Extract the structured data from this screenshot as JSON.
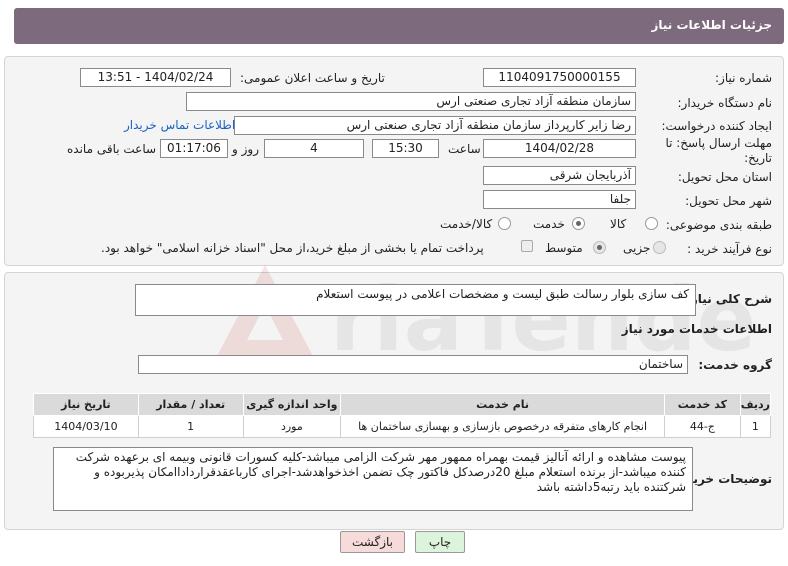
{
  "header": {
    "title": "جزئیات اطلاعات نیاز"
  },
  "form": {
    "need_number_label": "شماره نیاز:",
    "need_number": "1104091750000155",
    "announce_label": "تاریخ و ساعت اعلان عمومی:",
    "announce_value": "1404/02/24 - 13:51",
    "buyer_org_label": "نام دستگاه خریدار:",
    "buyer_org": "سازمان منطقه آزاد تجاری صنعتی ارس",
    "creator_label": "ایجاد کننده درخواست:",
    "creator": "رضا زایر کارپرداز سازمان منطقه آزاد تجاری صنعتی ارس",
    "contact_link": "اطلاعات تماس خریدار",
    "deadline_label_1": "مهلت ارسال پاسخ: تا",
    "deadline_label_2": "تاریخ:",
    "deadline_date": "1404/02/28",
    "time_label": "ساعت",
    "deadline_time": "15:30",
    "days_value": "4",
    "days_label": "روز و",
    "remaining_time": "01:17:06",
    "remaining_label": "ساعت باقی مانده",
    "province_label": "استان محل تحویل:",
    "province": "آذربایجان شرقی",
    "city_label": "شهر محل تحویل:",
    "city": "جلفا",
    "category_label": "طبقه بندی موضوعی:",
    "category_options": [
      "کالا",
      "خدمت",
      "کالا/خدمت"
    ],
    "category_selected": "خدمت",
    "process_label": "نوع فرآیند خرید :",
    "process_options": [
      "جزیی",
      "متوسط"
    ],
    "process_selected": "متوسط",
    "payment_note": "پرداخت تمام یا بخشی از مبلغ خرید،از محل \"اسناد خزانه اسلامی\" خواهد بود."
  },
  "summary": {
    "label": "شرح کلی نیاز:",
    "text": "کف سازی بلوار رسالت طبق لیست و مضخصات اعلامی در پیوست استعلام"
  },
  "services": {
    "section_title": "اطلاعات خدمات مورد نیاز",
    "group_label": "گروه خدمت:",
    "group_value": "ساختمان",
    "columns": [
      "ردیف",
      "کد خدمت",
      "نام خدمت",
      "واحد اندازه گیری",
      "تعداد / مقدار",
      "تاریخ نیاز"
    ],
    "rows": [
      [
        "1",
        "ج-44",
        "انجام کارهای متفرقه درخصوص بازسازی و بهسازی ساختمان ها",
        "مورد",
        "1",
        "1404/03/10"
      ]
    ]
  },
  "buyer_notes": {
    "label": "توضیحات خریدار:",
    "text": "پیوست مشاهده و ارائه آنالیز قیمت بهمراه ممهور مهر شرکت الزامی میباشد-کلیه کسورات قانونی وبیمه ای برعهده شرکت کننده میباشد-از برنده استعلام مبلغ 20درصدکل فاکتور چک تضمن اخذخواهدشد-اجرای کارباعقدقرارداداامکان پذیربوده و شرکتنده باید رتبه5داشته باشد"
  },
  "buttons": {
    "print": "چاپ",
    "back": "بازگشت"
  },
  "watermark": {
    "text": "AriaTender.net"
  },
  "colors": {
    "header": "#7d6a7d",
    "link": "#1a63c5",
    "back_button": "#f7dada",
    "print_button": "#dcf3dc"
  }
}
